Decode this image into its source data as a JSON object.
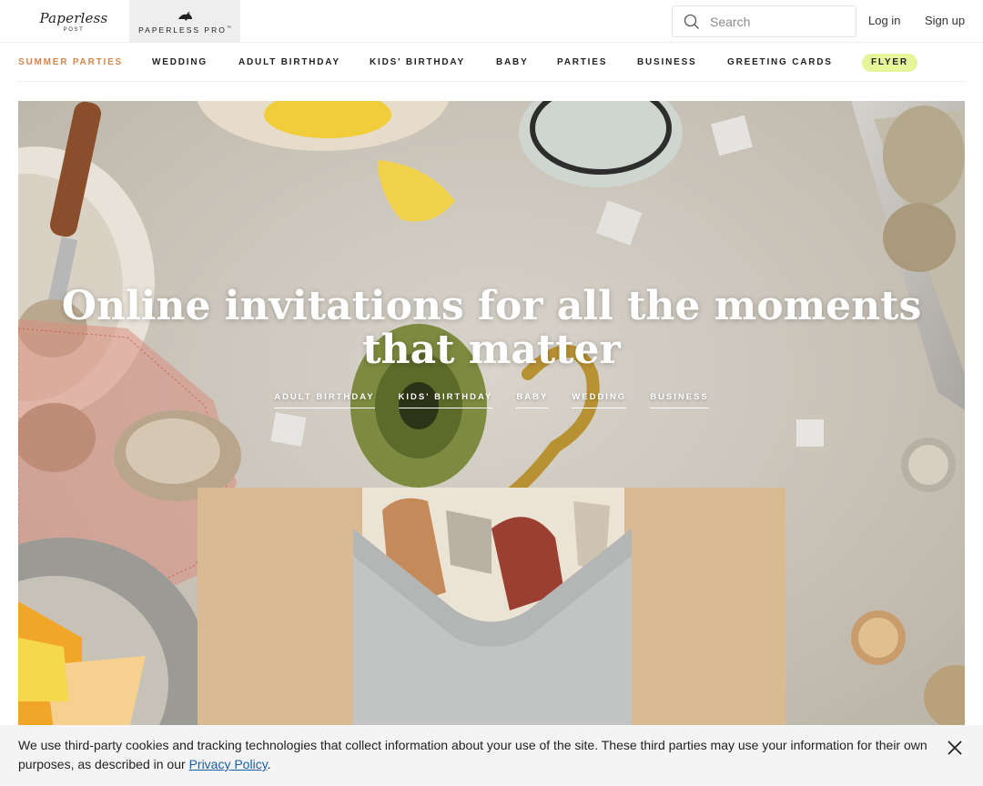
{
  "header": {
    "brand_script": "Paperless",
    "brand_sub": "POST",
    "brand_pro_label": "PAPERLESS PRO",
    "brand_pro_tm": "™",
    "search_placeholder": "Search",
    "login_label": "Log in",
    "signup_label": "Sign up"
  },
  "nav": {
    "items": [
      {
        "label": "SUMMER PARTIES"
      },
      {
        "label": "WEDDING"
      },
      {
        "label": "ADULT BIRTHDAY"
      },
      {
        "label": "KIDS' BIRTHDAY"
      },
      {
        "label": "BABY"
      },
      {
        "label": "PARTIES"
      },
      {
        "label": "BUSINESS"
      },
      {
        "label": "GREETING CARDS"
      },
      {
        "label": "FLYER"
      }
    ],
    "active_color": "#d4864a",
    "flyer_pill_color": "#e6f59a"
  },
  "hero": {
    "title_line1": "Online invitations for all the moments",
    "title_line2": "that matter",
    "links": [
      {
        "label": "ADULT BIRTHDAY"
      },
      {
        "label": "KIDS' BIRTHDAY"
      },
      {
        "label": "BABY"
      },
      {
        "label": "WEDDING"
      },
      {
        "label": "BUSINESS"
      }
    ]
  },
  "cookie": {
    "text": "We use third-party cookies and tracking technologies that collect information about your use of the site. These third parties may use your information for their own purposes, as described in our ",
    "link_label": "Privacy Policy",
    "suffix": "."
  }
}
